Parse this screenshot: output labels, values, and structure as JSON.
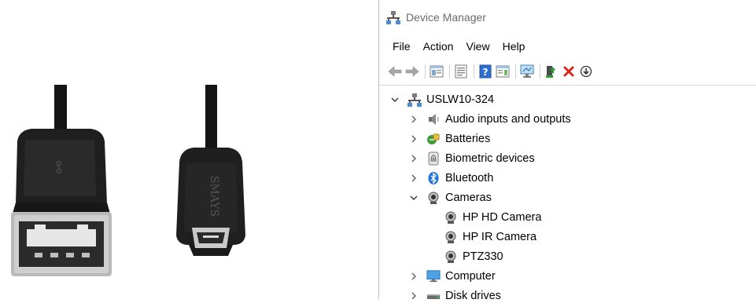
{
  "window": {
    "title": "Device Manager"
  },
  "menu": [
    "File",
    "Action",
    "View",
    "Help"
  ],
  "toolbar": [
    {
      "name": "back-icon"
    },
    {
      "name": "forward-icon"
    },
    {
      "sep": true
    },
    {
      "name": "properties-icon"
    },
    {
      "sep": true
    },
    {
      "name": "update-driver-icon"
    },
    {
      "sep": true
    },
    {
      "name": "help-icon"
    },
    {
      "name": "view-icon"
    },
    {
      "sep": true
    },
    {
      "name": "scan-hardware-icon"
    },
    {
      "sep": true
    },
    {
      "name": "add-driver-icon"
    },
    {
      "name": "uninstall-icon"
    },
    {
      "name": "download-icon"
    }
  ],
  "tree": {
    "root": "USLW10-324",
    "items": [
      {
        "label": "Audio inputs and outputs",
        "icon": "speaker-icon",
        "expanded": false
      },
      {
        "label": "Batteries",
        "icon": "battery-icon",
        "expanded": false
      },
      {
        "label": "Biometric devices",
        "icon": "fingerprint-icon",
        "expanded": false
      },
      {
        "label": "Bluetooth",
        "icon": "bluetooth-icon",
        "expanded": false
      },
      {
        "label": "Cameras",
        "icon": "webcam-icon",
        "expanded": true,
        "children": [
          "HP HD Camera",
          "HP IR Camera",
          "PTZ330"
        ]
      },
      {
        "label": "Computer",
        "icon": "monitor-icon",
        "expanded": false
      },
      {
        "label": "Disk drives",
        "icon": "disk-drive-icon",
        "expanded": false
      }
    ]
  },
  "colors": {
    "accent": "#1a73d9",
    "red": "#d9251c",
    "green": "#2e9b35"
  }
}
